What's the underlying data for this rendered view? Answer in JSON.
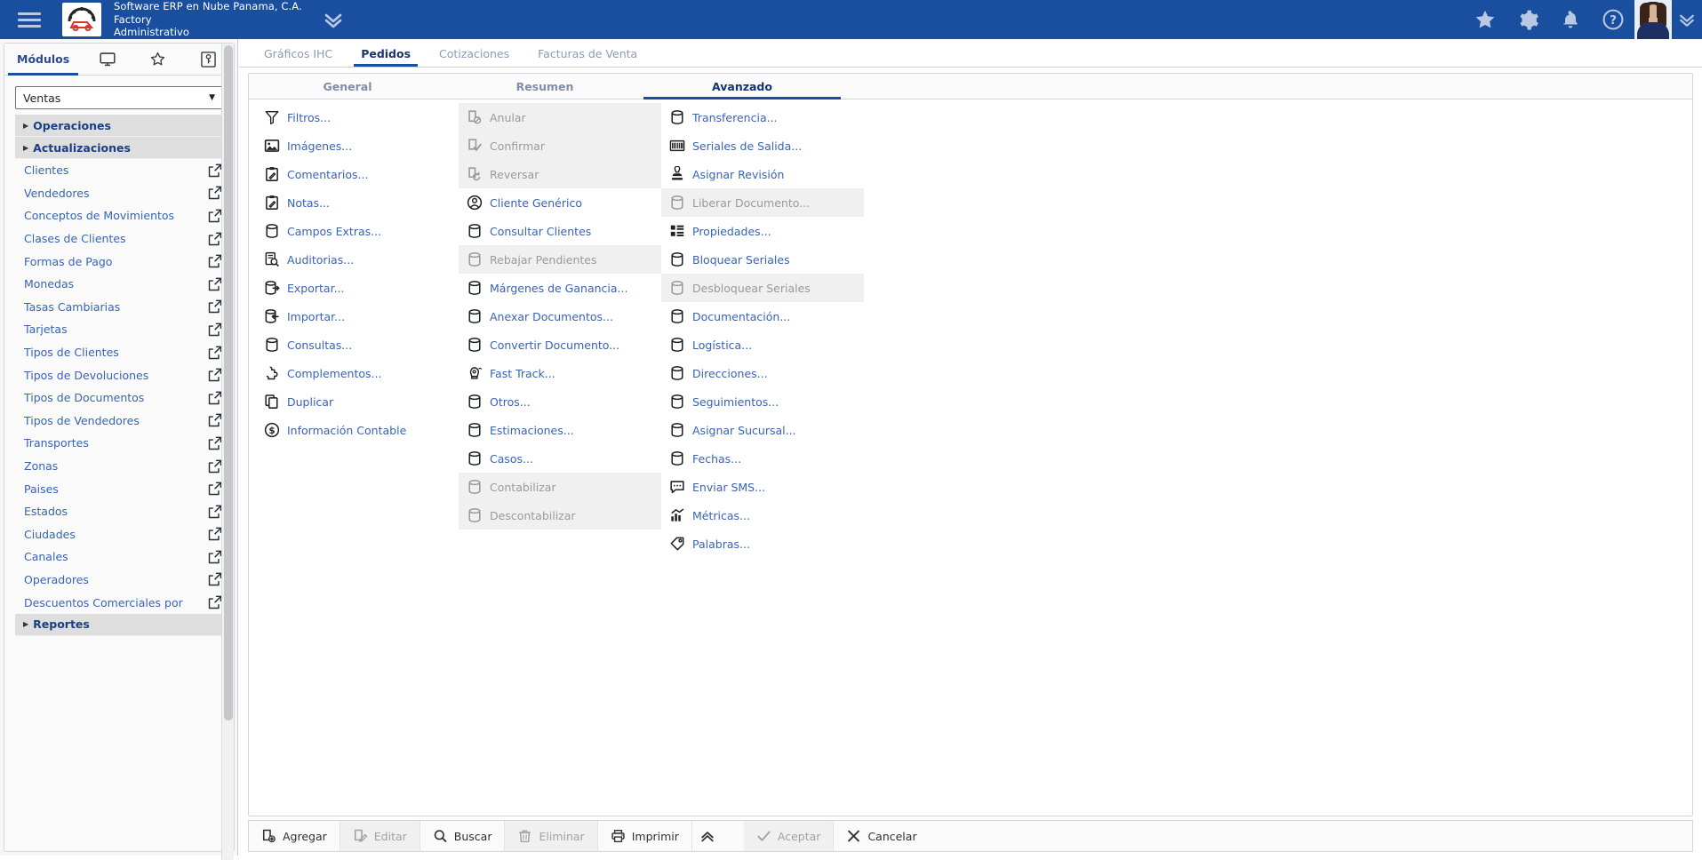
{
  "topbar": {
    "menu_icon": "hamburger-icon",
    "logo_alt": "car-gear-logo",
    "company": "Software ERP en Nube Panama, C.A.",
    "branch": "Factory",
    "role": "Administrativo",
    "expand_icon": "chevron-double-down-icon",
    "icons": [
      {
        "name": "favorites-star-icon",
        "glyph": "star"
      },
      {
        "name": "settings-gear-icon",
        "glyph": "gear"
      },
      {
        "name": "notifications-bell-icon",
        "glyph": "bell"
      },
      {
        "name": "help-question-icon",
        "glyph": "question"
      }
    ],
    "user_menu_icon": "chevron-double-down-icon",
    "bg_color": "#1a4fa0"
  },
  "sidebar": {
    "tabs": [
      {
        "label": "Módulos",
        "name": "sidebar-tab-modulos",
        "type": "text",
        "active": true
      },
      {
        "label": "",
        "name": "sidebar-tab-monitor",
        "type": "icon",
        "icon": "monitor-icon",
        "active": false
      },
      {
        "label": "",
        "name": "sidebar-tab-favorites",
        "type": "icon",
        "icon": "star-outline-icon",
        "active": false
      },
      {
        "label": "",
        "name": "sidebar-tab-key",
        "type": "icon",
        "icon": "key-icon",
        "active": false
      }
    ],
    "module_select": {
      "value": "Ventas",
      "caret": "▼"
    },
    "groups_and_items": [
      {
        "kind": "group",
        "label": "Operaciones",
        "name": "sidebar-group-operaciones"
      },
      {
        "kind": "group",
        "label": "Actualizaciones",
        "name": "sidebar-group-actualizaciones"
      },
      {
        "kind": "item",
        "label": "Clientes",
        "name": "sidebar-item-clientes"
      },
      {
        "kind": "item",
        "label": "Vendedores",
        "name": "sidebar-item-vendedores"
      },
      {
        "kind": "item",
        "label": "Conceptos de Movimientos",
        "name": "sidebar-item-conceptos-de-movimientos"
      },
      {
        "kind": "item",
        "label": "Clases de Clientes",
        "name": "sidebar-item-clases-de-clientes"
      },
      {
        "kind": "item",
        "label": "Formas de Pago",
        "name": "sidebar-item-formas-de-pago"
      },
      {
        "kind": "item",
        "label": "Monedas",
        "name": "sidebar-item-monedas"
      },
      {
        "kind": "item",
        "label": "Tasas Cambiarias",
        "name": "sidebar-item-tasas-cambiarias"
      },
      {
        "kind": "item",
        "label": "Tarjetas",
        "name": "sidebar-item-tarjetas"
      },
      {
        "kind": "item",
        "label": "Tipos de Clientes",
        "name": "sidebar-item-tipos-de-clientes"
      },
      {
        "kind": "item",
        "label": "Tipos de Devoluciones",
        "name": "sidebar-item-tipos-de-devoluciones"
      },
      {
        "kind": "item",
        "label": "Tipos de Documentos",
        "name": "sidebar-item-tipos-de-documentos"
      },
      {
        "kind": "item",
        "label": "Tipos de Vendedores",
        "name": "sidebar-item-tipos-de-vendedores"
      },
      {
        "kind": "item",
        "label": "Transportes",
        "name": "sidebar-item-transportes"
      },
      {
        "kind": "item",
        "label": "Zonas",
        "name": "sidebar-item-zonas"
      },
      {
        "kind": "item",
        "label": "Paises",
        "name": "sidebar-item-paises"
      },
      {
        "kind": "item",
        "label": "Estados",
        "name": "sidebar-item-estados"
      },
      {
        "kind": "item",
        "label": "Ciudades",
        "name": "sidebar-item-ciudades"
      },
      {
        "kind": "item",
        "label": "Canales",
        "name": "sidebar-item-canales"
      },
      {
        "kind": "item",
        "label": "Operadores",
        "name": "sidebar-item-operadores"
      },
      {
        "kind": "item",
        "label": "Descuentos Comerciales por",
        "name": "sidebar-item-descuentos-comerciales"
      },
      {
        "kind": "group",
        "label": "Reportes",
        "name": "sidebar-group-reportes"
      }
    ]
  },
  "document_tabs": [
    {
      "label": "Gráficos IHC",
      "name": "tab-graficos-ihc",
      "active": false
    },
    {
      "label": "Pedidos",
      "name": "tab-pedidos",
      "active": true
    },
    {
      "label": "Cotizaciones",
      "name": "tab-cotizaciones",
      "active": false
    },
    {
      "label": "Facturas de Venta",
      "name": "tab-facturas-de-venta",
      "active": false
    }
  ],
  "sub_tabs": [
    {
      "label": "General",
      "name": "subtab-general",
      "active": false
    },
    {
      "label": "Resumen",
      "name": "subtab-resumen",
      "active": false
    },
    {
      "label": "Avanzado",
      "name": "subtab-avanzado",
      "active": true
    }
  ],
  "columns": [
    {
      "name": "advanced-column-1",
      "items": [
        {
          "label": "Filtros...",
          "icon": "funnel-icon",
          "enabled": true,
          "name": "action-filtros"
        },
        {
          "label": "Imágenes...",
          "icon": "image-icon",
          "enabled": true,
          "name": "action-imagenes"
        },
        {
          "label": "Comentarios...",
          "icon": "clipboard-pencil-icon",
          "enabled": true,
          "name": "action-comentarios"
        },
        {
          "label": "Notas...",
          "icon": "clipboard-pencil-icon",
          "enabled": true,
          "name": "action-notas"
        },
        {
          "label": "Campos Extras...",
          "icon": "database-icon",
          "enabled": true,
          "name": "action-campos-extras"
        },
        {
          "label": "Auditorias...",
          "icon": "audit-search-icon",
          "enabled": true,
          "name": "action-auditorias"
        },
        {
          "label": "Exportar...",
          "icon": "database-export-icon",
          "enabled": true,
          "name": "action-exportar"
        },
        {
          "label": "Importar...",
          "icon": "database-import-icon",
          "enabled": true,
          "name": "action-importar"
        },
        {
          "label": "Consultas...",
          "icon": "database-icon",
          "enabled": true,
          "name": "action-consultas"
        },
        {
          "label": "Complementos...",
          "icon": "puzzle-icon",
          "enabled": true,
          "name": "action-complementos"
        },
        {
          "label": "Duplicar",
          "icon": "copy-icon",
          "enabled": true,
          "name": "action-duplicar"
        },
        {
          "label": "Información Contable",
          "icon": "dollar-circle-icon",
          "enabled": true,
          "name": "action-informacion-contable"
        }
      ]
    },
    {
      "name": "advanced-column-2",
      "items": [
        {
          "label": "Anular",
          "icon": "document-cancel-icon",
          "enabled": false,
          "name": "action-anular"
        },
        {
          "label": "Confirmar",
          "icon": "document-check-icon",
          "enabled": false,
          "name": "action-confirmar"
        },
        {
          "label": "Reversar",
          "icon": "document-revert-icon",
          "enabled": false,
          "name": "action-reversar"
        },
        {
          "label": "Cliente Genérico",
          "icon": "user-circle-icon",
          "enabled": true,
          "name": "action-cliente-generico"
        },
        {
          "label": "Consultar Clientes",
          "icon": "database-icon",
          "enabled": true,
          "name": "action-consultar-clientes"
        },
        {
          "label": "Rebajar Pendientes",
          "icon": "database-icon",
          "enabled": false,
          "name": "action-rebajar-pendientes"
        },
        {
          "label": "Márgenes de Ganancia...",
          "icon": "database-icon",
          "enabled": true,
          "name": "action-margenes-de-ganancia"
        },
        {
          "label": "Anexar Documentos...",
          "icon": "database-icon",
          "enabled": true,
          "name": "action-anexar-documentos"
        },
        {
          "label": "Convertir Documento...",
          "icon": "database-icon",
          "enabled": true,
          "name": "action-convertir-documento"
        },
        {
          "label": "Fast Track...",
          "icon": "rocket-icon",
          "enabled": true,
          "name": "action-fast-track"
        },
        {
          "label": "Otros...",
          "icon": "database-icon",
          "enabled": true,
          "name": "action-otros"
        },
        {
          "label": "Estimaciones...",
          "icon": "database-icon",
          "enabled": true,
          "name": "action-estimaciones"
        },
        {
          "label": "Casos...",
          "icon": "database-icon",
          "enabled": true,
          "name": "action-casos"
        },
        {
          "label": "Contabilizar",
          "icon": "database-icon",
          "enabled": false,
          "name": "action-contabilizar"
        },
        {
          "label": "Descontabilizar",
          "icon": "database-icon",
          "enabled": false,
          "name": "action-descontabilizar"
        }
      ]
    },
    {
      "name": "advanced-column-3",
      "items": [
        {
          "label": "Transferencia...",
          "icon": "database-icon",
          "enabled": true,
          "name": "action-transferencia"
        },
        {
          "label": "Seriales de Salida...",
          "icon": "barcode-icon",
          "enabled": true,
          "name": "action-seriales-de-salida"
        },
        {
          "label": "Asignar Revisión",
          "icon": "stamp-icon",
          "enabled": true,
          "name": "action-asignar-revision"
        },
        {
          "label": "Liberar Documento...",
          "icon": "database-icon",
          "enabled": false,
          "name": "action-liberar-documento"
        },
        {
          "label": "Propiedades...",
          "icon": "grid-properties-icon",
          "enabled": true,
          "name": "action-propiedades"
        },
        {
          "label": "Bloquear Seriales",
          "icon": "database-icon",
          "enabled": true,
          "name": "action-bloquear-seriales"
        },
        {
          "label": "Desbloquear Seriales",
          "icon": "database-icon",
          "enabled": false,
          "name": "action-desbloquear-seriales"
        },
        {
          "label": "Documentación...",
          "icon": "database-icon",
          "enabled": true,
          "name": "action-documentacion"
        },
        {
          "label": "Logística...",
          "icon": "database-icon",
          "enabled": true,
          "name": "action-logistica"
        },
        {
          "label": "Direcciones...",
          "icon": "database-icon",
          "enabled": true,
          "name": "action-direcciones"
        },
        {
          "label": "Seguimientos...",
          "icon": "database-icon",
          "enabled": true,
          "name": "action-seguimientos"
        },
        {
          "label": "Asignar Sucursal...",
          "icon": "database-icon",
          "enabled": true,
          "name": "action-asignar-sucursal"
        },
        {
          "label": "Fechas...",
          "icon": "database-icon",
          "enabled": true,
          "name": "action-fechas"
        },
        {
          "label": "Enviar SMS...",
          "icon": "chat-sms-icon",
          "enabled": true,
          "name": "action-enviar-sms"
        },
        {
          "label": "Métricas...",
          "icon": "chart-bars-icon",
          "enabled": true,
          "name": "action-metricas"
        },
        {
          "label": "Palabras...",
          "icon": "tag-icon",
          "enabled": true,
          "name": "action-palabras"
        }
      ]
    }
  ],
  "bottom_toolbar": [
    {
      "label": "Agregar",
      "icon": "add-document-icon",
      "enabled": true,
      "name": "agregar-button"
    },
    {
      "label": "Editar",
      "icon": "edit-document-icon",
      "enabled": false,
      "name": "editar-button"
    },
    {
      "label": "Buscar",
      "icon": "search-icon",
      "enabled": true,
      "name": "buscar-button"
    },
    {
      "label": "Eliminar",
      "icon": "trash-icon",
      "enabled": false,
      "name": "eliminar-button"
    },
    {
      "label": "Imprimir",
      "icon": "printer-icon",
      "enabled": true,
      "name": "imprimir-button"
    }
  ],
  "bottom_toolbar_right": [
    {
      "label": "Aceptar",
      "icon": "check-icon",
      "enabled": false,
      "name": "aceptar-button"
    },
    {
      "label": "Cancelar",
      "icon": "x-icon",
      "enabled": true,
      "name": "cancelar-button"
    }
  ],
  "bottom_collapse_icon": "chevron-double-up-icon",
  "colors": {
    "brand_blue": "#1a4fa0",
    "link_blue": "#3864b0",
    "active_tab": "#16356f",
    "disabled_bg": "#f0f0f0",
    "disabled_text": "#9a9a9a"
  }
}
